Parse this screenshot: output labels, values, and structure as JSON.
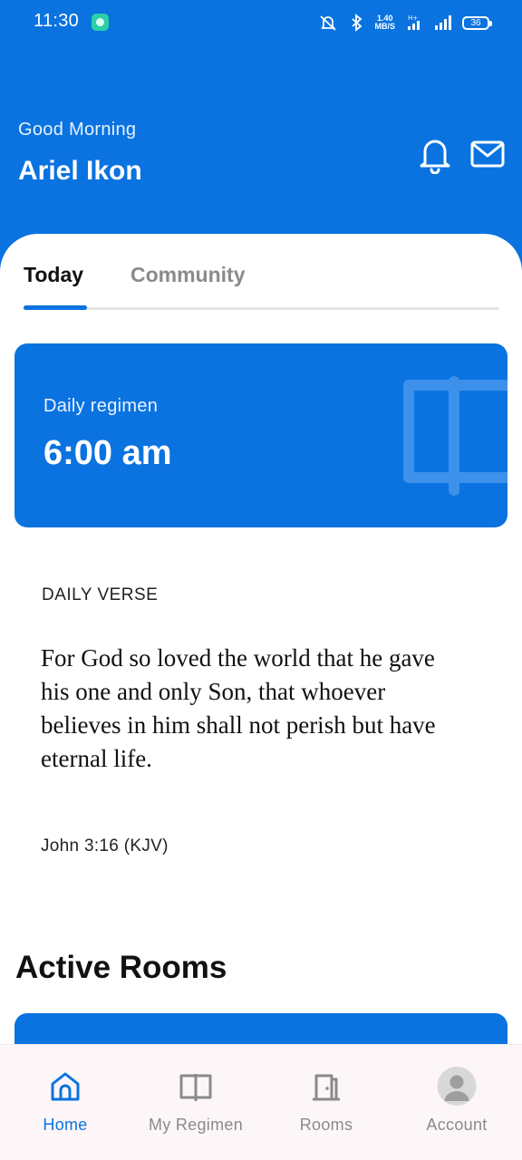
{
  "status_bar": {
    "time": "11:30",
    "network_speed": "1.40",
    "network_speed_unit": "MB/S",
    "network_type": "H+",
    "battery": "36"
  },
  "header": {
    "greeting": "Good Morning",
    "user_name": "Ariel Ikon",
    "icons": [
      "bell-icon",
      "mail-icon"
    ]
  },
  "tabs": [
    {
      "label": "Today",
      "active": true
    },
    {
      "label": "Community",
      "active": false
    }
  ],
  "regimen_card": {
    "label": "Daily regimen",
    "time": "6:00 am",
    "icon": "open-book-icon"
  },
  "daily_verse": {
    "heading": "DAILY VERSE",
    "text": "For God so loved the world that he gave his one and only Son, that whoever believes in him shall not perish but have eternal life.",
    "reference": "John 3:16 (KJV)"
  },
  "active_rooms": {
    "heading": "Active Rooms"
  },
  "bottom_nav": [
    {
      "label": "Home",
      "icon": "home-icon",
      "active": true
    },
    {
      "label": "My Regimen",
      "icon": "book-icon",
      "active": false
    },
    {
      "label": "Rooms",
      "icon": "door-icon",
      "active": false
    },
    {
      "label": "Account",
      "icon": "avatar-icon",
      "active": false
    }
  ],
  "colors": {
    "primary": "#0a73e0",
    "tab_inactive": "#8a8a8a",
    "nav_background": "#fdf6f8"
  }
}
